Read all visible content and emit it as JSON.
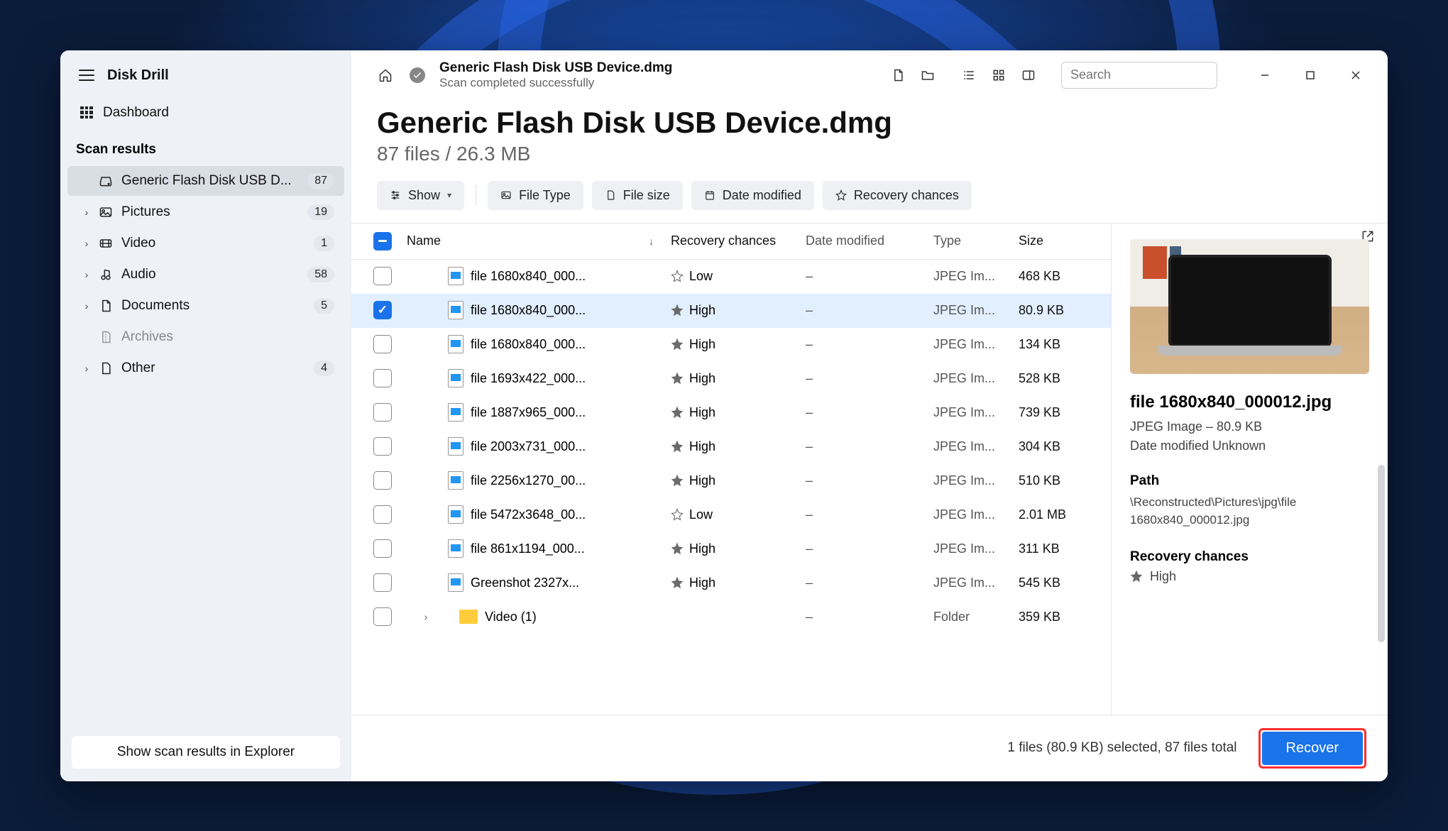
{
  "app": {
    "name": "Disk Drill"
  },
  "sidebar": {
    "dashboard": "Dashboard",
    "scan_results_label": "Scan results",
    "items": [
      {
        "label": "Generic Flash Disk USB D...",
        "count": "87",
        "icon": "disk",
        "selected": true,
        "expandable": false
      },
      {
        "label": "Pictures",
        "count": "19",
        "icon": "picture",
        "expandable": true
      },
      {
        "label": "Video",
        "count": "1",
        "icon": "video",
        "expandable": true
      },
      {
        "label": "Audio",
        "count": "58",
        "icon": "audio",
        "expandable": true
      },
      {
        "label": "Documents",
        "count": "5",
        "icon": "document",
        "expandable": true
      },
      {
        "label": "Archives",
        "count": "",
        "icon": "archive",
        "muted": true,
        "expandable": false
      },
      {
        "label": "Other",
        "count": "4",
        "icon": "other",
        "expandable": true
      }
    ],
    "explorer_button": "Show scan results in Explorer"
  },
  "topbar": {
    "title": "Generic Flash Disk USB Device.dmg",
    "subtitle": "Scan completed successfully",
    "search_placeholder": "Search"
  },
  "page": {
    "title": "Generic Flash Disk USB Device.dmg",
    "subtitle": "87 files / 26.3 MB"
  },
  "filters": {
    "show": "Show",
    "file_type": "File Type",
    "file_size": "File size",
    "date_modified": "Date modified",
    "recovery_chances": "Recovery chances"
  },
  "table": {
    "columns": {
      "name": "Name",
      "recovery": "Recovery chances",
      "date": "Date modified",
      "type": "Type",
      "size": "Size"
    },
    "rows": [
      {
        "name": "file 1680x840_000...",
        "recovery": "Low",
        "date": "–",
        "type": "JPEG Im...",
        "size": "468 KB",
        "checked": false,
        "kind": "file"
      },
      {
        "name": "file 1680x840_000...",
        "recovery": "High",
        "date": "–",
        "type": "JPEG Im...",
        "size": "80.9 KB",
        "checked": true,
        "kind": "file",
        "selected": true
      },
      {
        "name": "file 1680x840_000...",
        "recovery": "High",
        "date": "–",
        "type": "JPEG Im...",
        "size": "134 KB",
        "checked": false,
        "kind": "file"
      },
      {
        "name": "file 1693x422_000...",
        "recovery": "High",
        "date": "–",
        "type": "JPEG Im...",
        "size": "528 KB",
        "checked": false,
        "kind": "file"
      },
      {
        "name": "file 1887x965_000...",
        "recovery": "High",
        "date": "–",
        "type": "JPEG Im...",
        "size": "739 KB",
        "checked": false,
        "kind": "file"
      },
      {
        "name": "file 2003x731_000...",
        "recovery": "High",
        "date": "–",
        "type": "JPEG Im...",
        "size": "304 KB",
        "checked": false,
        "kind": "file"
      },
      {
        "name": "file 2256x1270_00...",
        "recovery": "High",
        "date": "–",
        "type": "JPEG Im...",
        "size": "510 KB",
        "checked": false,
        "kind": "file"
      },
      {
        "name": "file 5472x3648_00...",
        "recovery": "Low",
        "date": "–",
        "type": "JPEG Im...",
        "size": "2.01 MB",
        "checked": false,
        "kind": "file"
      },
      {
        "name": "file 861x1194_000...",
        "recovery": "High",
        "date": "–",
        "type": "JPEG Im...",
        "size": "311 KB",
        "checked": false,
        "kind": "file"
      },
      {
        "name": "Greenshot 2327x...",
        "recovery": "High",
        "date": "–",
        "type": "JPEG Im...",
        "size": "545 KB",
        "checked": false,
        "kind": "file"
      },
      {
        "name": "Video (1)",
        "recovery": "",
        "date": "–",
        "type": "Folder",
        "size": "359 KB",
        "checked": false,
        "kind": "folder"
      }
    ]
  },
  "preview": {
    "filename": "file 1680x840_000012.jpg",
    "meta": "JPEG Image – 80.9 KB",
    "modified": "Date modified Unknown",
    "path_label": "Path",
    "path": "\\Reconstructed\\Pictures\\jpg\\file 1680x840_000012.jpg",
    "recovery_label": "Recovery chances",
    "recovery_value": "High"
  },
  "footer": {
    "status": "1 files (80.9 KB) selected, 87 files total",
    "recover": "Recover"
  },
  "colors": {
    "accent": "#1a73e8",
    "highlight": "#ff2e2e"
  }
}
